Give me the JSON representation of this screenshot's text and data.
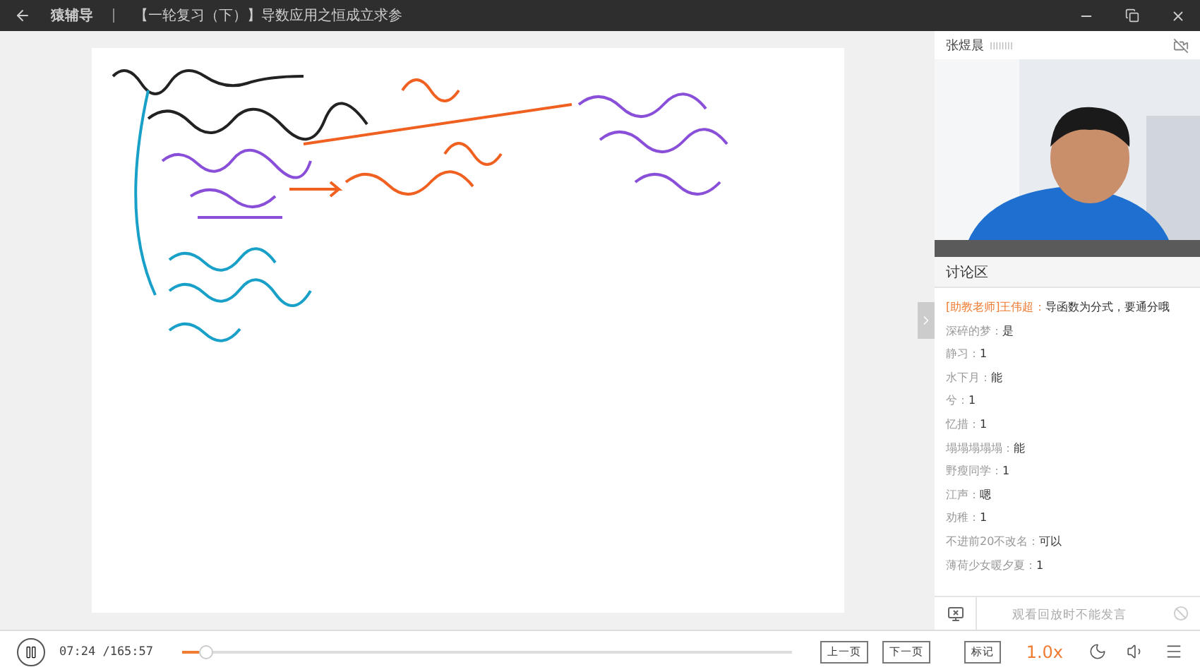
{
  "title_bar": {
    "app": "猿辅导",
    "course": "【一轮复习（下）】导数应用之恒成立求参"
  },
  "camera": {
    "name": "张煜晨",
    "signal": "IIIIIIII"
  },
  "discussion": {
    "title": "讨论区",
    "messages": [
      {
        "kind": "teacher",
        "name": "[助教老师]王伟超",
        "sep": "：",
        "text": "导函数为分式，要通分哦"
      },
      {
        "kind": "student",
        "name": "深碎的梦",
        "sep": "：",
        "text": "是"
      },
      {
        "kind": "student",
        "name": "静习",
        "sep": "：",
        "text": "1"
      },
      {
        "kind": "student",
        "name": "水下月",
        "sep": "：",
        "text": "能"
      },
      {
        "kind": "student",
        "name": "兮",
        "sep": "：",
        "text": "1"
      },
      {
        "kind": "student",
        "name": "忆措",
        "sep": "：",
        "text": "1"
      },
      {
        "kind": "student",
        "name": "塌塌塌塌塌",
        "sep": "：",
        "text": "能"
      },
      {
        "kind": "student",
        "name": "野瘦同学",
        "sep": "：",
        "text": "1"
      },
      {
        "kind": "student",
        "name": "江声",
        "sep": "：",
        "text": "嗯"
      },
      {
        "kind": "student",
        "name": "劝稚",
        "sep": "：",
        "text": "1"
      },
      {
        "kind": "student",
        "name": "不进前20不改名",
        "sep": "：",
        "text": "可以"
      },
      {
        "kind": "student",
        "name": "薄荷少女暖夕夏",
        "sep": "：",
        "text": "1"
      }
    ],
    "input_placeholder": "观看回放时不能发言"
  },
  "player": {
    "playing": true,
    "time": "07:24 /165:57",
    "level": 0.03,
    "buttons": [
      "上一页",
      "下一页",
      "标记"
    ],
    "speed": "1.0x"
  }
}
